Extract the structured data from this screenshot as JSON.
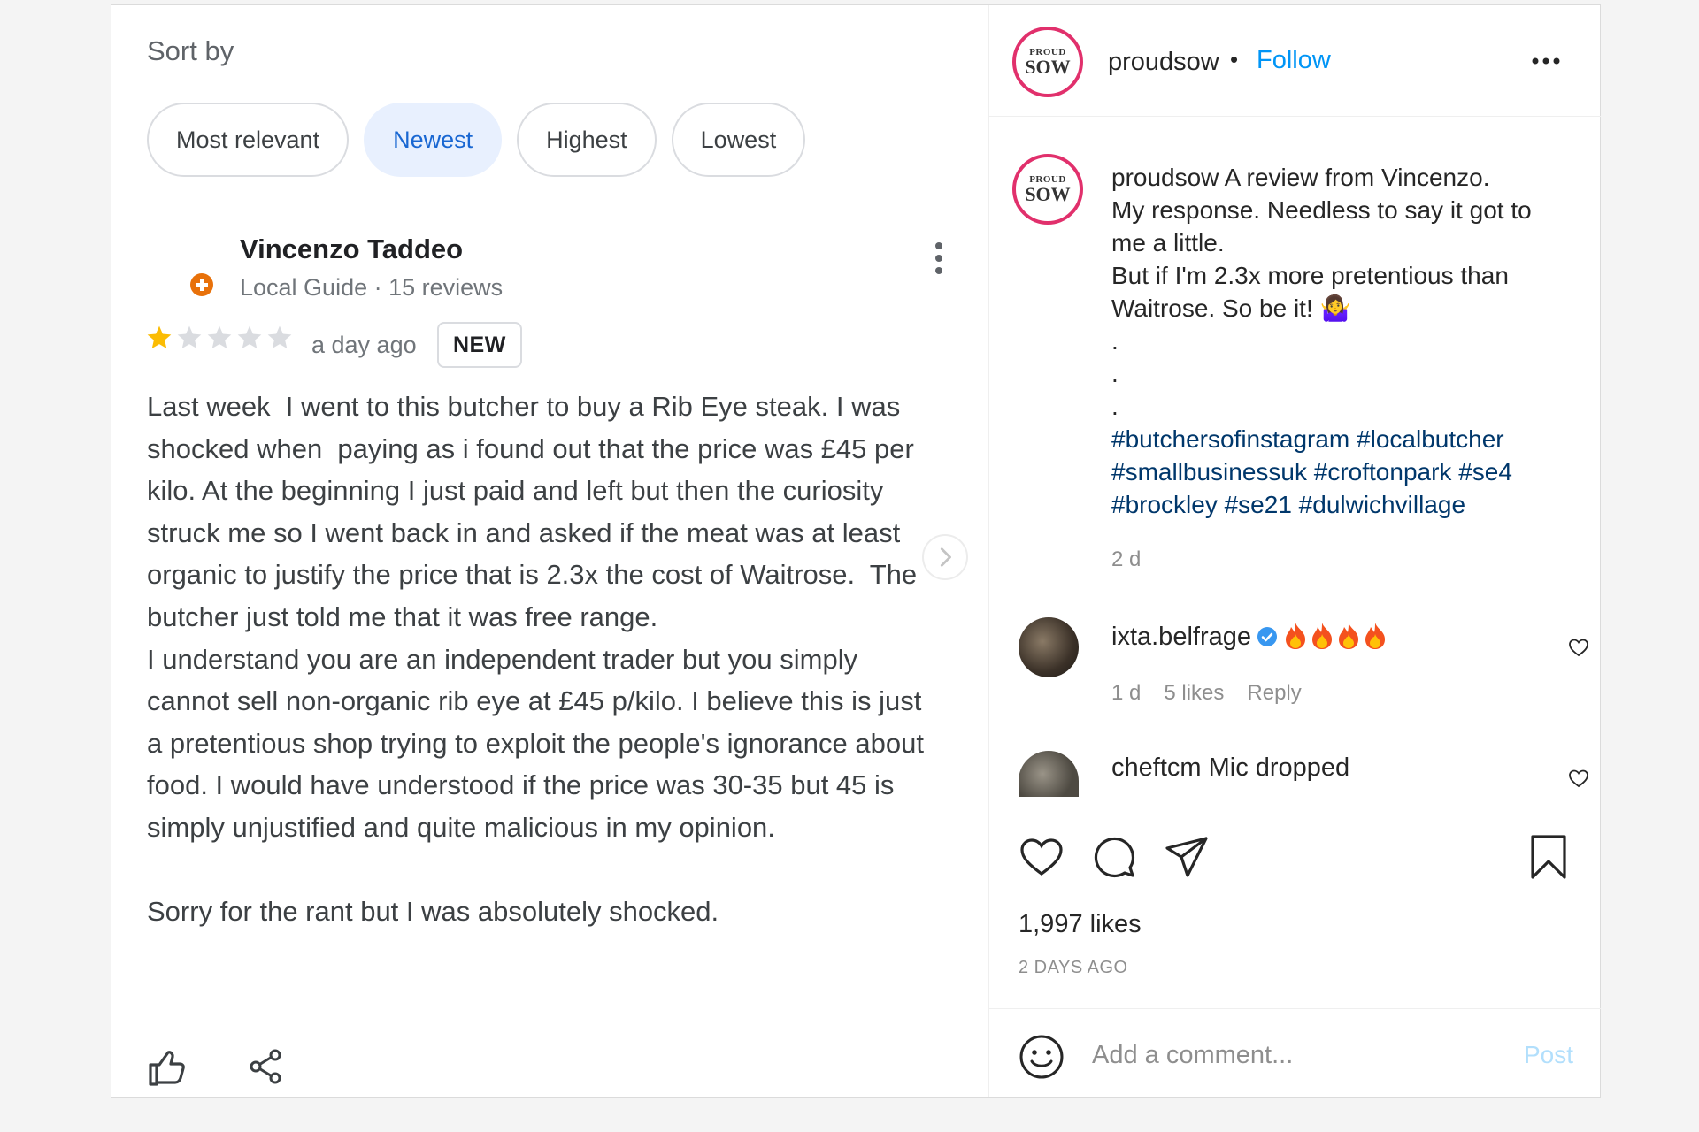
{
  "review": {
    "sort_label": "Sort by",
    "chips": [
      "Most relevant",
      "Newest",
      "Highest",
      "Lowest"
    ],
    "active_chip": "Newest",
    "reviewer_name": "Vincenzo Taddeo",
    "reviewer_meta": "Local Guide · 15 reviews",
    "rating": 1,
    "rating_max": 5,
    "date": "a day ago",
    "badge": "NEW",
    "text": "Last week  I went to this butcher to buy a Rib Eye steak. I was shocked when  paying as i found out that the price was £45 per kilo. At the beginning I just paid and left but then the curiosity struck me so I went back in and asked if the meat was at least organic to justify the price that is 2.3x the cost of Waitrose.  The butcher just told me that it was free range.\nI understand you are an independent trader but you simply cannot sell non-organic rib eye at £45 p/kilo. I believe this is just a pretentious shop trying to exploit the people's ignorance about food. I would have understood if the price was 30-35 but 45 is simply unjustified and quite malicious in my opinion.\n\nSorry for the rant but I was absolutely shocked."
  },
  "post": {
    "avatar_top": "PROUD",
    "avatar_main": "SOW",
    "username": "proudsow",
    "separator": "•",
    "follow_label": "Follow",
    "caption_user": "proudsow",
    "caption_lines": " A review from Vincenzo.\nMy response. Needless to say it got to me a little.\nBut if I'm 2.3x more pretentious than Waitrose. So be it! 🤷‍♀️\n.\n.\n.\n",
    "hashtags": "#butchersofinstagram #localbutcher #smallbusinessuk #croftonpark #se4 #brockley #se21 #dulwichvillage",
    "caption_time": "2 d",
    "comments": [
      {
        "user": "ixta.belfrage",
        "text": "",
        "verified": true,
        "fires": 4,
        "time": "1 d",
        "likes": "5 likes",
        "reply": "Reply"
      },
      {
        "user": "cheftcm",
        "text": "Mic dropped"
      }
    ],
    "likes": "1,997 likes",
    "posted": "2 DAYS AGO",
    "comment_placeholder": "Add a comment...",
    "post_label": "Post"
  },
  "colors": {
    "accent": "#0095f6",
    "chip_active_bg": "#e8f0fe",
    "chip_active_text": "#1967d2",
    "star": "#fbbc04",
    "avatar_ring": "#e1306c"
  },
  "icons": [
    "local-guide-icon",
    "more-vert-icon",
    "star-icon",
    "chevron-right-icon",
    "thumb-up-icon",
    "share-icon",
    "more-horiz-icon",
    "verified-icon",
    "fire-icon",
    "heart-icon",
    "comment-icon",
    "send-icon",
    "bookmark-icon",
    "smile-icon"
  ]
}
